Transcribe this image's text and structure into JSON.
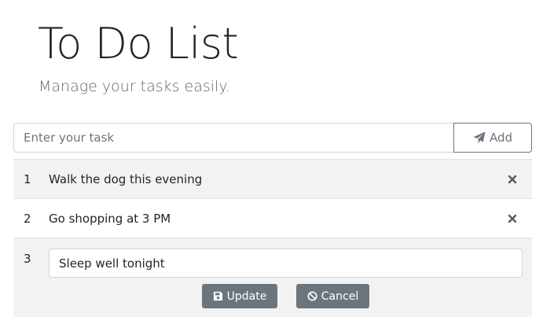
{
  "header": {
    "title": "To Do List",
    "subtitle": "Manage your tasks easily."
  },
  "new_task": {
    "placeholder": "Enter your task",
    "value": "",
    "add_label": "Add",
    "add_icon": "paper-plane-icon"
  },
  "tasks": [
    {
      "number": "1",
      "text": "Walk the dog this evening",
      "delete_icon": "close-icon"
    },
    {
      "number": "2",
      "text": "Go shopping at 3 PM",
      "delete_icon": "close-icon"
    },
    {
      "number": "3",
      "text": "Sleep well tonight",
      "editing": true
    }
  ],
  "edit": {
    "update_label": "Update",
    "update_icon": "save-icon",
    "cancel_label": "Cancel",
    "cancel_icon": "ban-icon"
  },
  "colors": {
    "text": "#212529",
    "muted": "#6c757d",
    "border": "#dee2e6",
    "striped_row": "#f2f2f2",
    "button_secondary": "#6c757d"
  }
}
